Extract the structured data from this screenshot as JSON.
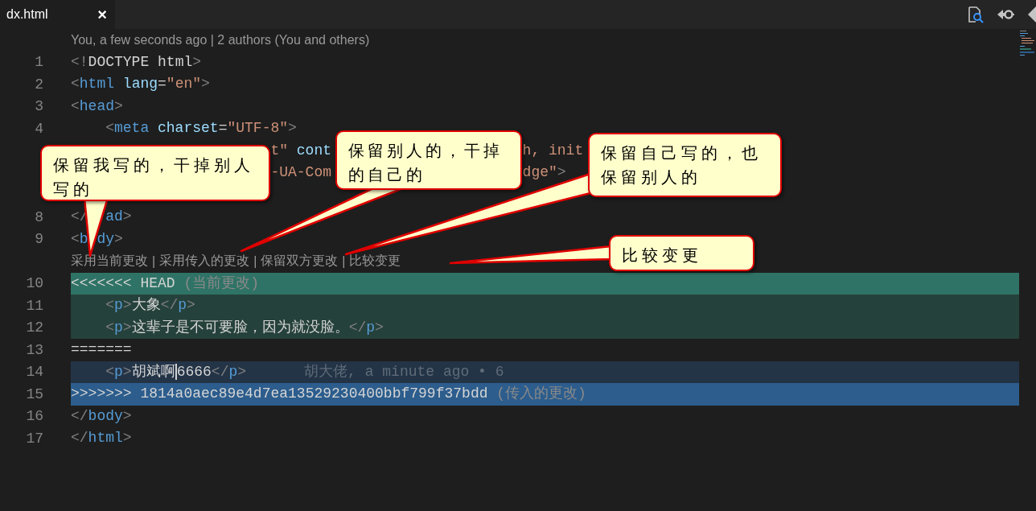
{
  "tabs": [
    {
      "label": "dx.html",
      "selected": true,
      "close": "×"
    }
  ],
  "rows": [
    {
      "kind": "lens",
      "text": "You, a few seconds ago | 2 authors (You and others)"
    },
    {
      "kind": "code",
      "number": "1",
      "tokens": [
        {
          "kind": "punct",
          "t": "<!"
        },
        {
          "kind": "plain",
          "t": "DOCTYPE html"
        },
        {
          "kind": "punct",
          "t": ">"
        }
      ]
    },
    {
      "kind": "code",
      "number": "2",
      "tokens": [
        {
          "kind": "punct",
          "t": "<"
        },
        {
          "kind": "tag",
          "t": "html"
        },
        {
          "kind": "attr",
          "t": " lang"
        },
        {
          "kind": "plain",
          "t": "="
        },
        {
          "kind": "string",
          "t": "\"en\""
        },
        {
          "kind": "punct",
          "t": ">"
        }
      ]
    },
    {
      "kind": "code",
      "number": "3",
      "tokens": [
        {
          "kind": "punct",
          "t": "<"
        },
        {
          "kind": "tag",
          "t": "head"
        },
        {
          "kind": "punct",
          "t": ">"
        }
      ]
    },
    {
      "kind": "code",
      "number": "4",
      "indented": true,
      "tokens": [
        {
          "kind": "punct",
          "t": "<"
        },
        {
          "kind": "tag",
          "t": "meta"
        },
        {
          "kind": "attr",
          "t": " charset"
        },
        {
          "kind": "plain",
          "t": "="
        },
        {
          "kind": "string",
          "t": "\"UTF-8\""
        },
        {
          "kind": "punct",
          "t": ">"
        }
      ]
    },
    {
      "kind": "partial",
      "segments": [
        [
          {
            "kind": "string",
            "t": "t\""
          },
          {
            "kind": "attr",
            "t": " cont"
          }
        ],
        [
          {
            "kind": "string",
            "t": "h, init"
          }
        ]
      ]
    },
    {
      "kind": "partial",
      "segments": [
        [
          {
            "kind": "string",
            "t": "-UA-Com"
          }
        ],
        [
          {
            "kind": "string",
            "t": "dge\""
          },
          {
            "kind": "punct",
            "t": ">"
          }
        ]
      ]
    },
    {
      "kind": "partial",
      "segments": []
    },
    {
      "kind": "partial",
      "number": "8",
      "segments": [
        [
          {
            "kind": "punct",
            "t": "</"
          }
        ],
        [
          {
            "kind": "tag",
            "t": "ad"
          },
          {
            "kind": "punct",
            "t": ">"
          }
        ]
      ]
    },
    {
      "kind": "partial",
      "number": "9",
      "segments": [
        [
          {
            "kind": "punct",
            "t": "<"
          },
          {
            "kind": "tag",
            "t": "b"
          }
        ],
        [
          {
            "kind": "tag",
            "t": "dy"
          },
          {
            "kind": "punct",
            "t": ">"
          }
        ]
      ]
    },
    {
      "kind": "actions",
      "actions": [
        "采用当前更改",
        "采用传入的更改",
        "保留双方更改",
        "比较变更"
      ],
      "separator": "|"
    },
    {
      "kind": "current-header",
      "number": "10",
      "tokens": [
        {
          "kind": "plain",
          "t": "<<<<<<< HEAD"
        },
        {
          "kind": "note",
          "t": " (当前更改)"
        }
      ]
    },
    {
      "kind": "current",
      "number": "11",
      "indented": true,
      "tokens": [
        {
          "kind": "punct",
          "t": "<"
        },
        {
          "kind": "tag",
          "t": "p"
        },
        {
          "kind": "punct",
          "t": ">"
        },
        {
          "kind": "plain",
          "t": "大象"
        },
        {
          "kind": "punct",
          "t": "</"
        },
        {
          "kind": "tag",
          "t": "p"
        },
        {
          "kind": "punct",
          "t": ">"
        }
      ]
    },
    {
      "kind": "current",
      "number": "12",
      "indented": true,
      "tokens": [
        {
          "kind": "punct",
          "t": "<"
        },
        {
          "kind": "tag",
          "t": "p"
        },
        {
          "kind": "punct",
          "t": ">"
        },
        {
          "kind": "plain",
          "t": "这辈子是不可要脸，因为就没脸。"
        },
        {
          "kind": "punct",
          "t": "</"
        },
        {
          "kind": "tag",
          "t": "p"
        },
        {
          "kind": "punct",
          "t": ">"
        }
      ]
    },
    {
      "kind": "code",
      "number": "13",
      "tokens": [
        {
          "kind": "plain",
          "t": "======="
        }
      ]
    },
    {
      "kind": "incoming",
      "number": "14",
      "indented": true,
      "blame": "胡大佬, a minute ago • 6",
      "tokens": [
        {
          "kind": "punct",
          "t": "<"
        },
        {
          "kind": "tag",
          "t": "p"
        },
        {
          "kind": "punct",
          "t": ">"
        },
        {
          "kind": "plain",
          "t": "胡斌啊",
          "caret": true
        },
        {
          "kind": "plain",
          "t": "6666"
        },
        {
          "kind": "punct",
          "t": "</"
        },
        {
          "kind": "tag",
          "t": "p"
        },
        {
          "kind": "punct",
          "t": ">"
        }
      ]
    },
    {
      "kind": "incoming-header",
      "number": "15",
      "tokens": [
        {
          "kind": "plain",
          "t": ">>>>>>> 1814a0aec89e4d7ea13529230400bbf799f37bdd"
        },
        {
          "kind": "note",
          "t": " (传入的更改)"
        }
      ]
    },
    {
      "kind": "code",
      "number": "16",
      "tokens": [
        {
          "kind": "punct",
          "t": "</"
        },
        {
          "kind": "tag",
          "t": "body"
        },
        {
          "kind": "punct",
          "t": ">"
        }
      ]
    },
    {
      "kind": "code",
      "number": "17",
      "tokens": [
        {
          "kind": "punct",
          "t": "</"
        },
        {
          "kind": "tag",
          "t": "html"
        },
        {
          "kind": "punct",
          "t": ">"
        }
      ]
    }
  ],
  "callouts": [
    "保留我写的，干掉别人写的",
    "保留别人的，干掉的自己的",
    "保留自己写的，也保留别人的",
    "比较变更"
  ]
}
